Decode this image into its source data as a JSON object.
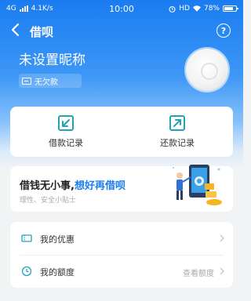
{
  "status_bar": {
    "network": "4G",
    "speed": "4.1K/s",
    "time": "10:00",
    "hd": "HD",
    "battery": "78%"
  },
  "nav": {
    "title": "借呗",
    "help_glyph": "?"
  },
  "profile": {
    "nickname": "未设置昵称",
    "tag": "无欠款"
  },
  "records": {
    "borrow_label": "借款记录",
    "repay_label": "还款记录"
  },
  "promo": {
    "title_prefix": "借钱无小事,",
    "title_highlight": "想好再借呗",
    "subtitle": "理性、安全小贴士"
  },
  "menu": {
    "coupons_label": "我的优惠",
    "quota_label": "我的额度",
    "quota_hint": "查看额度"
  },
  "colors": {
    "brand_blue": "#1a7cf0",
    "icon_teal": "#22a3b8"
  }
}
